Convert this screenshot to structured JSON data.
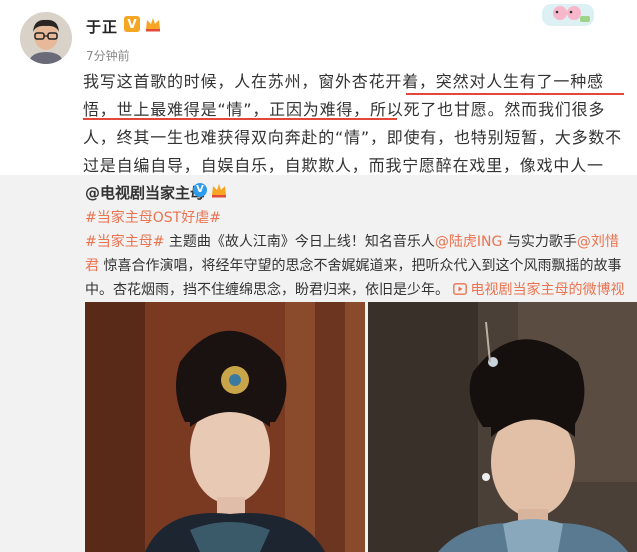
{
  "user": {
    "name": "于正",
    "time": "7分钟前",
    "verified_icon": "v-badge-icon",
    "member_icon": "crown-icon"
  },
  "post": {
    "text": "我写这首歌的时候，人在苏州，窗外杏花开着，突然对人生有了一种感悟，世上最难得是“情”，正因为难得，所以死了也甘愿。然而我们很多人，终其一生也难获得双向奔赴的“情”，即使有，也特别短暂，大多数不过是自编自导，自娱自乐，自欺欺人，而我宁愿醉在戏里，像戏中人一样，一眼万年，更多怀念。",
    "highlight_color": "#e2473a"
  },
  "repost": {
    "author": "@电视剧当家主母",
    "tag": "#当家主母OST好虐#",
    "body_tag": "#当家主母#",
    "body_1": " 主题曲《故人江南》今日上线！知名音乐人",
    "mention_1": "@陆虎ING",
    "body_2": " 与实力歌手",
    "mention_2": "@刘惜君",
    "body_3": " 惊喜合作演唱，将经年守望的思念不舍娓娓道来，把听众代入到这个风雨飘摇的故事中。杏花烟雨，挡不住缠绵思念，盼君归来，依旧是少年。 ",
    "video_link": "电视剧当家主母的微博视频",
    "accent_color": "#eb7350",
    "background": "#f2f2f2"
  }
}
